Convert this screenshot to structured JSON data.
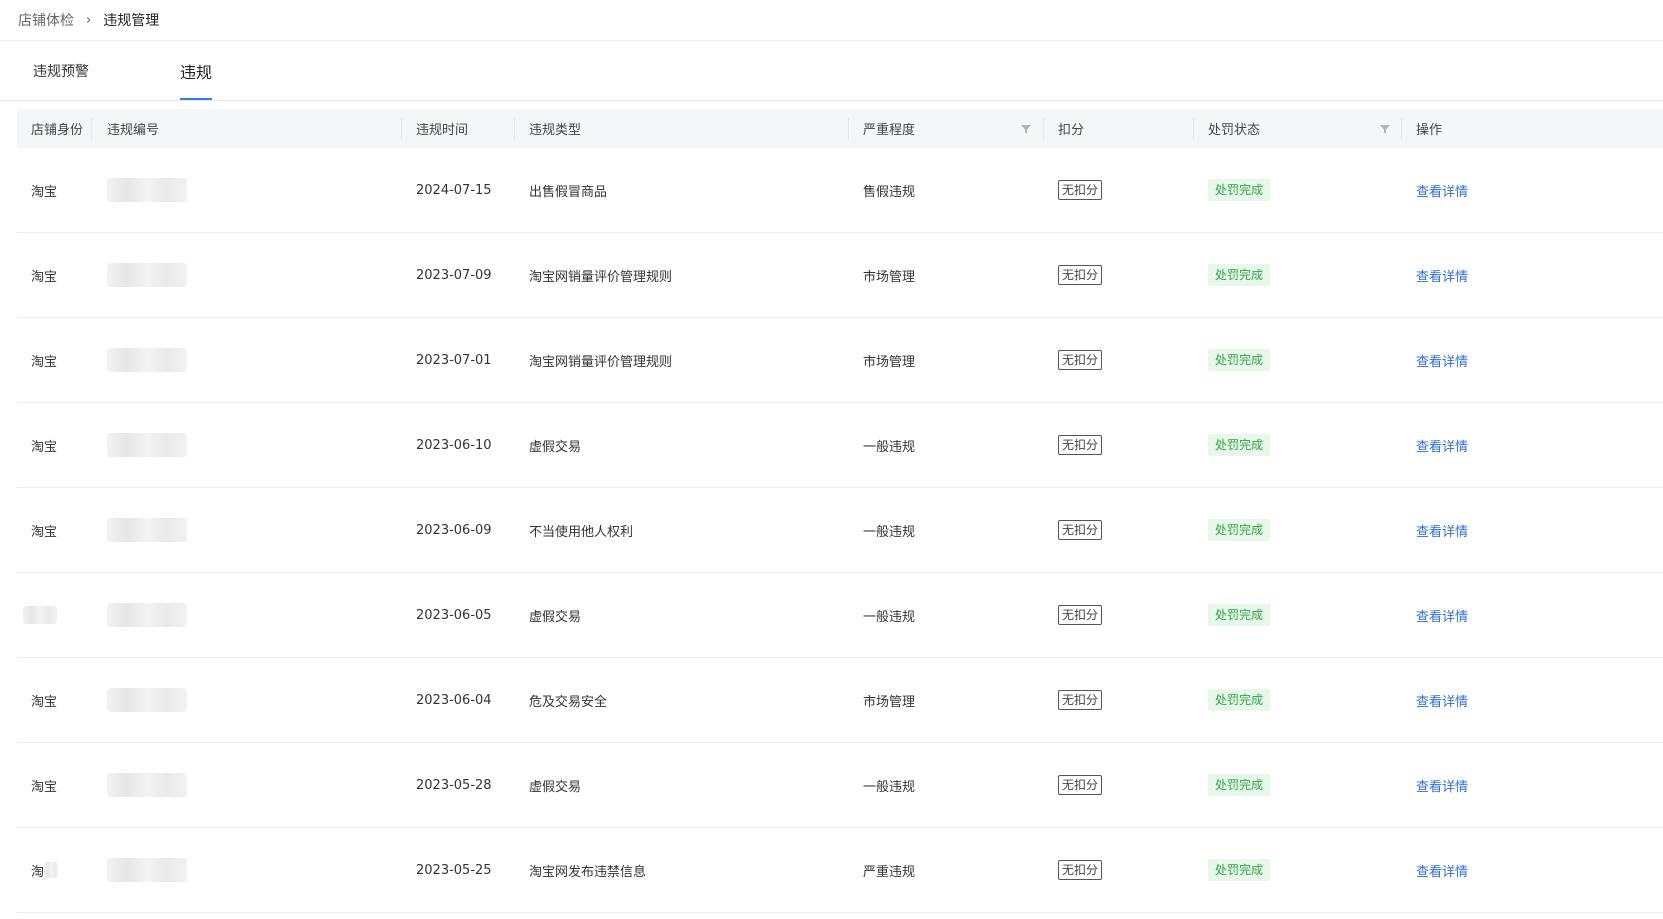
{
  "breadcrumb": {
    "parent": "店铺体检",
    "separator": "›",
    "current": "违规管理"
  },
  "tabs": [
    {
      "label": "违规预警",
      "active": false
    },
    {
      "label": "违规",
      "active": true
    }
  ],
  "table": {
    "columns": {
      "identity": "店铺身份",
      "number": "违规编号",
      "time": "违规时间",
      "type": "违规类型",
      "severity": "严重程度",
      "deduct": "扣分",
      "status": "处罚状态",
      "action": "操作"
    },
    "rows": [
      {
        "identity": "淘宝",
        "time": "2024-07-15",
        "type": "出售假冒商品",
        "severity": "售假违规",
        "deduct": "无扣分",
        "status": "处罚完成",
        "action": "查看详情"
      },
      {
        "identity": "淘宝",
        "time": "2023-07-09",
        "type": "淘宝网销量评价管理规则",
        "severity": "市场管理",
        "deduct": "无扣分",
        "status": "处罚完成",
        "action": "查看详情"
      },
      {
        "identity": "淘宝",
        "time": "2023-07-01",
        "type": "淘宝网销量评价管理规则",
        "severity": "市场管理",
        "deduct": "无扣分",
        "status": "处罚完成",
        "action": "查看详情"
      },
      {
        "identity": "淘宝",
        "time": "2023-06-10",
        "type": "虚假交易",
        "severity": "一般违规",
        "deduct": "无扣分",
        "status": "处罚完成",
        "action": "查看详情"
      },
      {
        "identity": "淘宝",
        "time": "2023-06-09",
        "type": "不当使用他人权利",
        "severity": "一般违规",
        "deduct": "无扣分",
        "status": "处罚完成",
        "action": "查看详情"
      },
      {
        "identity": "",
        "time": "2023-06-05",
        "type": "虚假交易",
        "severity": "一般违规",
        "deduct": "无扣分",
        "status": "处罚完成",
        "action": "查看详情"
      },
      {
        "identity": "淘宝",
        "time": "2023-06-04",
        "type": "危及交易安全",
        "severity": "市场管理",
        "deduct": "无扣分",
        "status": "处罚完成",
        "action": "查看详情"
      },
      {
        "identity": "淘宝",
        "time": "2023-05-28",
        "type": "虚假交易",
        "severity": "一般违规",
        "deduct": "无扣分",
        "status": "处罚完成",
        "action": "查看详情"
      },
      {
        "identity": "淘",
        "time": "2023-05-25",
        "type": "淘宝网发布违禁信息",
        "severity": "严重违规",
        "deduct": "无扣分",
        "status": "处罚完成",
        "action": "查看详情"
      }
    ]
  },
  "icons": {
    "filter": "filter-icon"
  },
  "colors": {
    "accent": "#2f7bf0",
    "link": "#2f6fd8",
    "status_bg": "#e8f7ea",
    "status_text": "#2ea545"
  }
}
